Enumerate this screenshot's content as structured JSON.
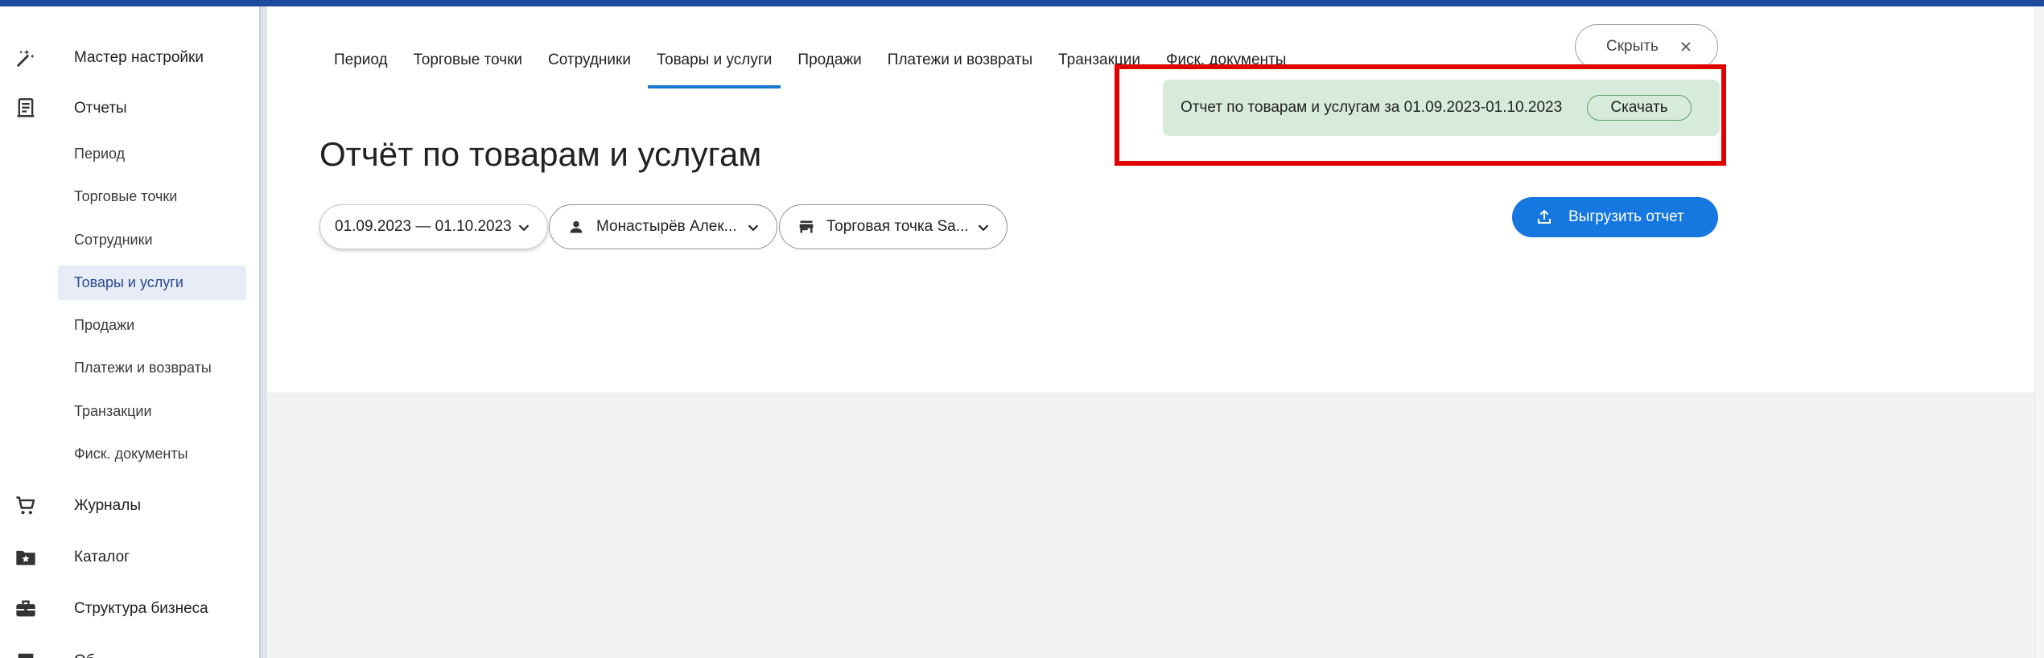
{
  "sidebar": {
    "top_items": [
      {
        "label": "Мастер настройки",
        "icon": "magic-wand-icon"
      },
      {
        "label": "Отчеты",
        "icon": "report-icon"
      },
      {
        "label": "Журналы",
        "icon": "cart-icon"
      },
      {
        "label": "Каталог",
        "icon": "folder-star-icon"
      },
      {
        "label": "Структура бизнеса",
        "icon": "briefcase-icon"
      },
      {
        "label": "Об",
        "icon": "document-icon"
      }
    ],
    "report_items": [
      {
        "label": "Период"
      },
      {
        "label": "Торговые точки"
      },
      {
        "label": "Сотрудники"
      },
      {
        "label": "Товары и услуги",
        "active": true
      },
      {
        "label": "Продажи"
      },
      {
        "label": "Платежи и возвраты"
      },
      {
        "label": "Транзакции"
      },
      {
        "label": "Фиск. документы"
      }
    ]
  },
  "tabs": [
    {
      "label": "Период"
    },
    {
      "label": "Торговые точки"
    },
    {
      "label": "Сотрудники"
    },
    {
      "label": "Товары и услуги",
      "active": true
    },
    {
      "label": "Продажи"
    },
    {
      "label": "Платежи и возвраты"
    },
    {
      "label": "Транзакции"
    },
    {
      "label": "Фиск. документы"
    }
  ],
  "hide_button": {
    "label": "Скрыть"
  },
  "notification": {
    "text": "Отчет по товарам и услугам за 01.09.2023-01.10.2023",
    "download_label": "Скачать"
  },
  "page": {
    "title": "Отчёт по товарам и услугам"
  },
  "filters": {
    "date_range": "01.09.2023 — 01.10.2023",
    "employee": "Монастырёв Алек...",
    "point": "Торговая точка Sa..."
  },
  "export_button": {
    "label": "Выгрузить отчет"
  },
  "colors": {
    "accent": "#1976d2",
    "export_button": "#1677e0",
    "notice_bg": "#d7ebda",
    "highlight_frame": "#e00000",
    "top_strip": "#1d4a9c"
  }
}
